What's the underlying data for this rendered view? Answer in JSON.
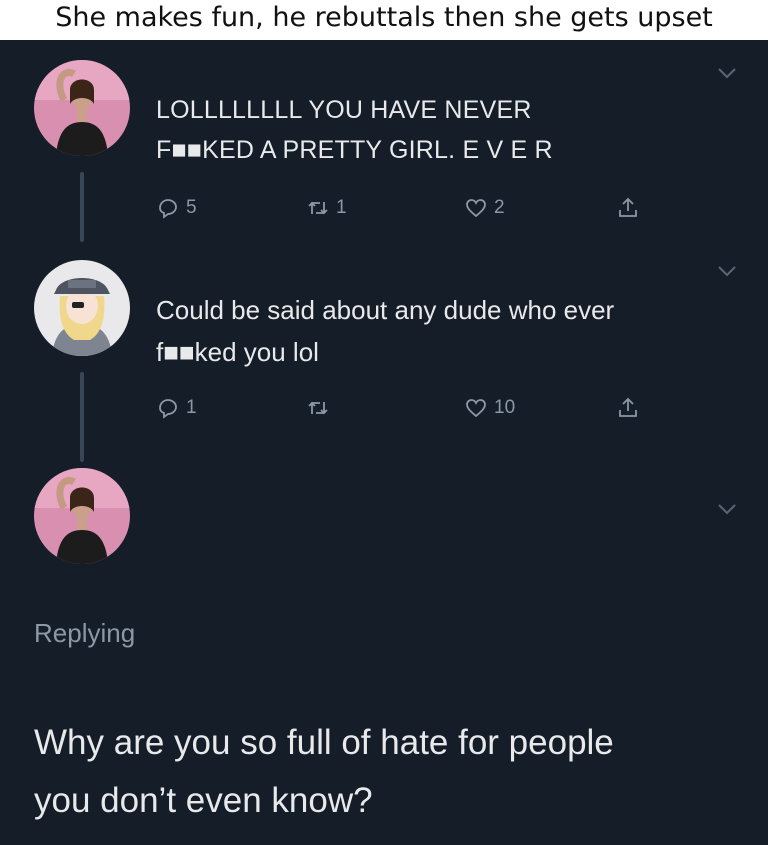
{
  "caption": "She makes fun, he rebuttals then she gets upset",
  "tweets": [
    {
      "line1": "LOLLLLLLLL YOU HAVE NEVER",
      "line2": "F■■KED A PRETTY GIRL. E V E R",
      "replies": "5",
      "retweets": "1",
      "likes": "2"
    },
    {
      "line1": "Could be said about any dude who ever",
      "line2": "f■■ked you lol",
      "replies": "1",
      "retweets": "",
      "likes": "10"
    }
  ],
  "reply": {
    "replying_label": "Replying",
    "text_line1": "Why are you so full of hate for people",
    "text_line2": "you don’t even know?"
  },
  "colors": {
    "background": "#151d29",
    "text": "#e7e9ea",
    "muted": "#8b98a5"
  },
  "icons": [
    "reply-icon",
    "retweet-icon",
    "like-icon",
    "share-icon",
    "chevron-down-icon"
  ]
}
